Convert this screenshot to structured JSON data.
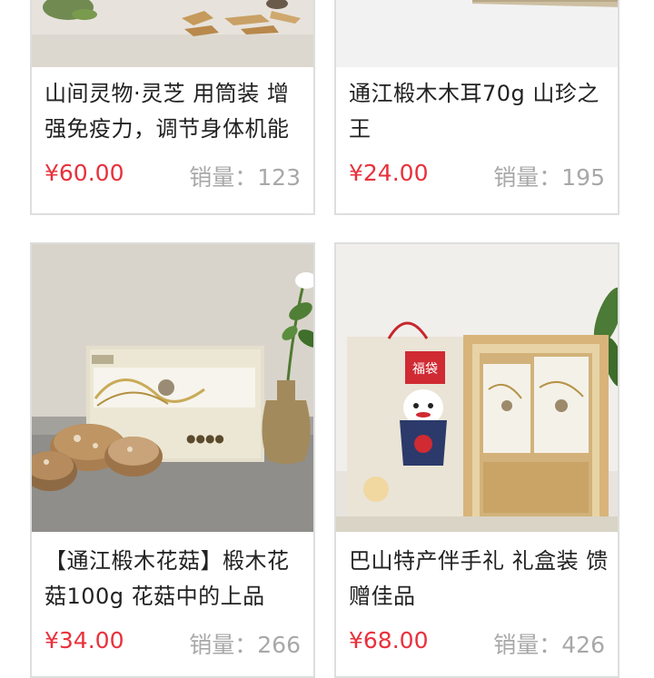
{
  "products": [
    {
      "title": "山间灵物·灵芝 用筒装 增强免疫力，调节身体机能",
      "price": "¥60.00",
      "sales_label": "销量：",
      "sales_count": "123"
    },
    {
      "title": "通江椴木木耳70g 山珍之王",
      "price": "¥24.00",
      "sales_label": "销量：",
      "sales_count": "195"
    },
    {
      "title": "【通江椴木花菇】椴木花菇100g 花菇中的上品",
      "price": "¥34.00",
      "sales_label": "销量：",
      "sales_count": "266"
    },
    {
      "title": "巴山特产伴手礼 礼盒装 馈赠佳品",
      "price": "¥68.00",
      "sales_label": "销量：",
      "sales_count": "426"
    }
  ],
  "colors": {
    "price": "#e8313c",
    "sales": "#a8a8a8",
    "title": "#222222",
    "card_border": "#dedede"
  }
}
